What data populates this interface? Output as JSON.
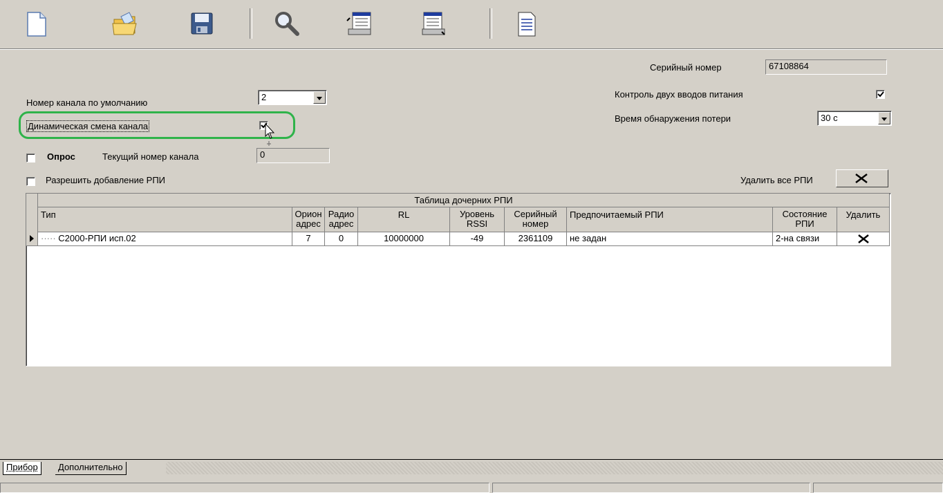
{
  "toolbar": {
    "buttons": [
      {
        "icon": "new-document-icon"
      },
      {
        "icon": "open-folder-icon"
      },
      {
        "icon": "save-disk-icon"
      },
      {
        "icon": "search-magnifier-icon"
      },
      {
        "icon": "read-config-icon"
      },
      {
        "icon": "write-config-icon"
      },
      {
        "icon": "report-document-icon"
      }
    ]
  },
  "panel": {
    "serial_label": "Серийный номер",
    "serial_value": "67108864",
    "dual_power_label": "Контроль двух вводов питания",
    "dual_power_checked": true,
    "loss_time_label": "Время обнаружения потери",
    "loss_time_value": "30 с",
    "default_channel_label": "Номер канала по умолчанию",
    "default_channel_value": "2",
    "dynamic_channel_label": "Динамическая смена канала",
    "dynamic_channel_checked": true,
    "poll_label": "Опрос",
    "poll_checked": false,
    "current_channel_label": "Текущий номер канала",
    "current_channel_value": "0",
    "allow_add_label": "Разрешить добавление РПИ",
    "allow_add_checked": false,
    "delete_all_label": "Удалить все РПИ",
    "highlight_color": "#2fb34a"
  },
  "grid": {
    "caption": "Таблица дочерних РПИ",
    "columns": [
      "Тип",
      "Орион адрес",
      "Радио адрес",
      "RL",
      "Уровень RSSI",
      "Серийный номер",
      "Предпочитаемый РПИ",
      "Состояние РПИ",
      "Удалить"
    ],
    "rows": [
      {
        "type": "С2000-РПИ исп.02",
        "orion": "7",
        "radio": "0",
        "rl": "10000000",
        "rssi": "-49",
        "serial": "2361109",
        "preferred": "не задан",
        "state": "2-на связи"
      }
    ]
  },
  "tabs": [
    {
      "label": "Прибор",
      "active": true
    },
    {
      "label": "Дополнительно",
      "active": false
    }
  ]
}
